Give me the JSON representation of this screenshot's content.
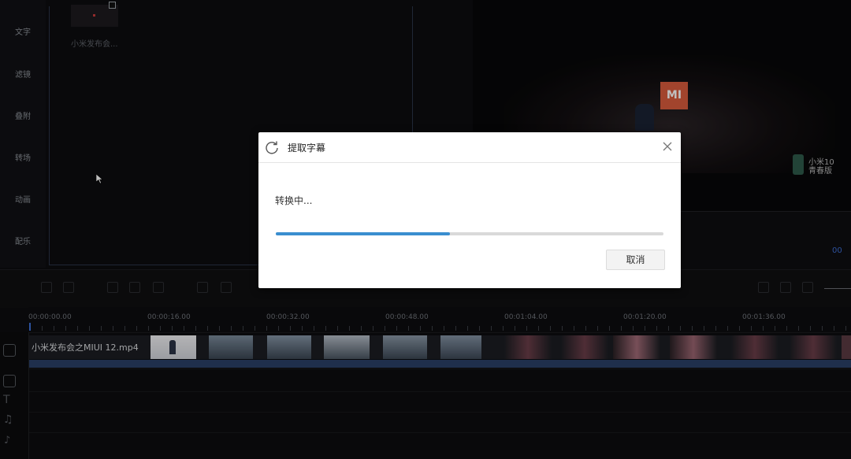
{
  "sidebar": {
    "items": [
      {
        "label": "文字"
      },
      {
        "label": "滤镜"
      },
      {
        "label": "叠附"
      },
      {
        "label": "转场"
      },
      {
        "label": "动画"
      },
      {
        "label": "配乐"
      }
    ]
  },
  "media": {
    "clip_label": "小米发布会..."
  },
  "preview": {
    "logo_text": "MI",
    "product_line1": "小米10",
    "product_line2": "青春版",
    "time_fragment": "00"
  },
  "timeline": {
    "ruler_labels": [
      "00:00:00.00",
      "00:00:16.00",
      "00:00:32.00",
      "00:00:48.00",
      "00:01:04.00",
      "00:01:20.00",
      "00:01:36.00"
    ],
    "video_track_label": "小米发布会之MIUI 12.mp4"
  },
  "dialog": {
    "title": "提取字幕",
    "status": "转换中...",
    "progress": 0.45,
    "cancel_label": "取消",
    "refresh_icon": "refresh-icon",
    "close_icon": "close-icon"
  },
  "colors": {
    "accent": "#3a8ed0",
    "timeline_accent": "#3d6fd6",
    "brand_mi": "#d85b3c"
  }
}
